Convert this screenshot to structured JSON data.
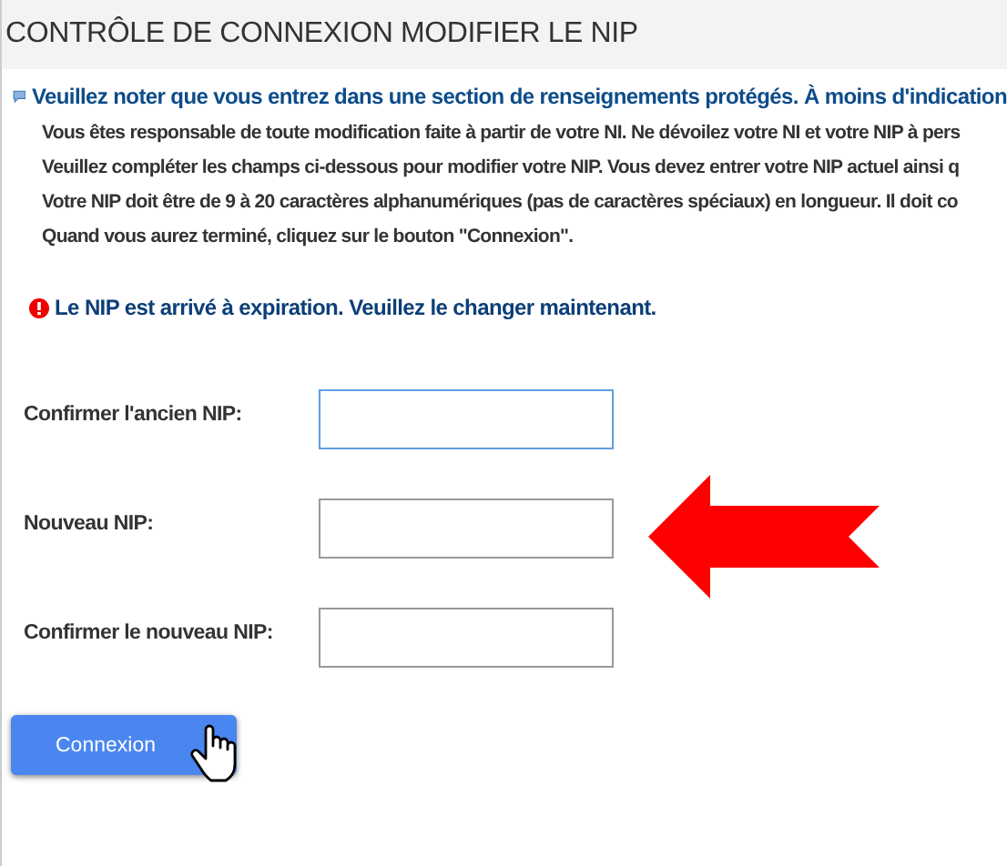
{
  "page": {
    "title": "CONTRÔLE DE CONNEXION MODIFIER LE NIP"
  },
  "notice": {
    "heading": "Veuillez noter que vous entrez dans une section de renseignements protégés. À moins d'indication",
    "paragraphs": [
      "Vous êtes responsable de toute modification faite à partir de votre NI. Ne dévoilez votre NI et votre NIP à pers",
      "Veuillez compléter les champs ci-dessous pour modifier votre NIP. Vous devez entrer votre NIP actuel ainsi q",
      "Votre NIP doit être de 9 à 20 caractères alphanumériques (pas de caractères spéciaux) en longueur. Il doit co",
      "Quand vous aurez terminé, cliquez sur le bouton \"Connexion\"."
    ]
  },
  "error": "Le NIP est arrivé à expiration. Veuillez le changer maintenant.",
  "fields": [
    {
      "label": "Confirmer l'ancien NIP:",
      "focused": true,
      "pointed": false
    },
    {
      "label": "Nouveau NIP:",
      "focused": false,
      "pointed": true
    },
    {
      "label": "Confirmer le nouveau NIP:",
      "focused": false,
      "pointed": false
    }
  ],
  "submit": {
    "label": "Connexion",
    "hovered": true
  }
}
